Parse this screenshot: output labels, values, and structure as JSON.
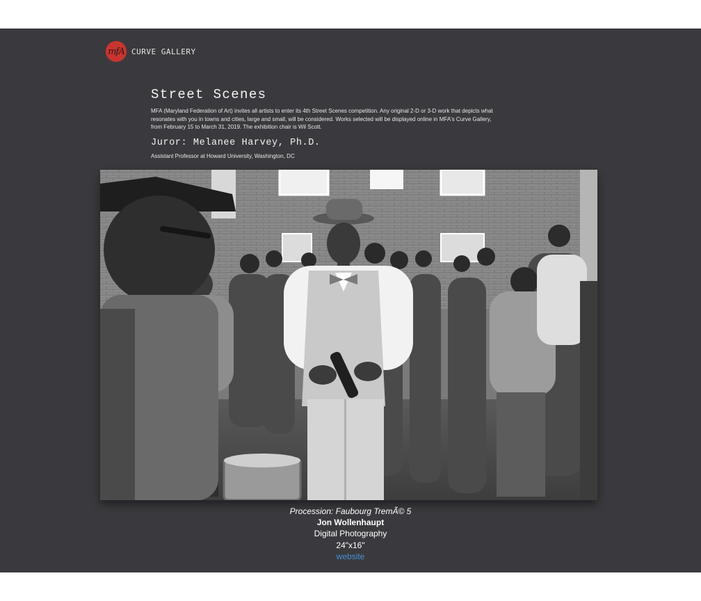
{
  "brand": {
    "logo_letters": "mfA",
    "name": "CURVE GALLERY"
  },
  "exhibition": {
    "title": "Street Scenes",
    "description": "MFA (Maryland Federation of Art) invites all artists to enter its 4th Street Scenes competition. Any original 2-D or 3-D work that depicts what resonates with you in towns and cities, large and small, will be considered. Works selected will be displayed online in MFA's Curve Gallery, from February 15 to March 31, 2019. The exhibition chair is Wil Scott.",
    "juror": "Juror: Melanee Harvey, Ph.D.",
    "juror_affiliation": "Assistant Professor at Howard University, Washington, DC"
  },
  "artwork": {
    "title": "Procession: Faubourg Tremé 5",
    "title_display": "Procession: Faubourg TremÃ© 5",
    "artist": "Jon Wollenhaupt",
    "medium": "Digital Photography",
    "size": "24\"x16\"",
    "link_label": "website"
  },
  "colors": {
    "page_background": "#3a3a3e",
    "outer_background": "#ffffff",
    "logo_red": "#c8352e",
    "link_blue": "#4a8fd6"
  }
}
